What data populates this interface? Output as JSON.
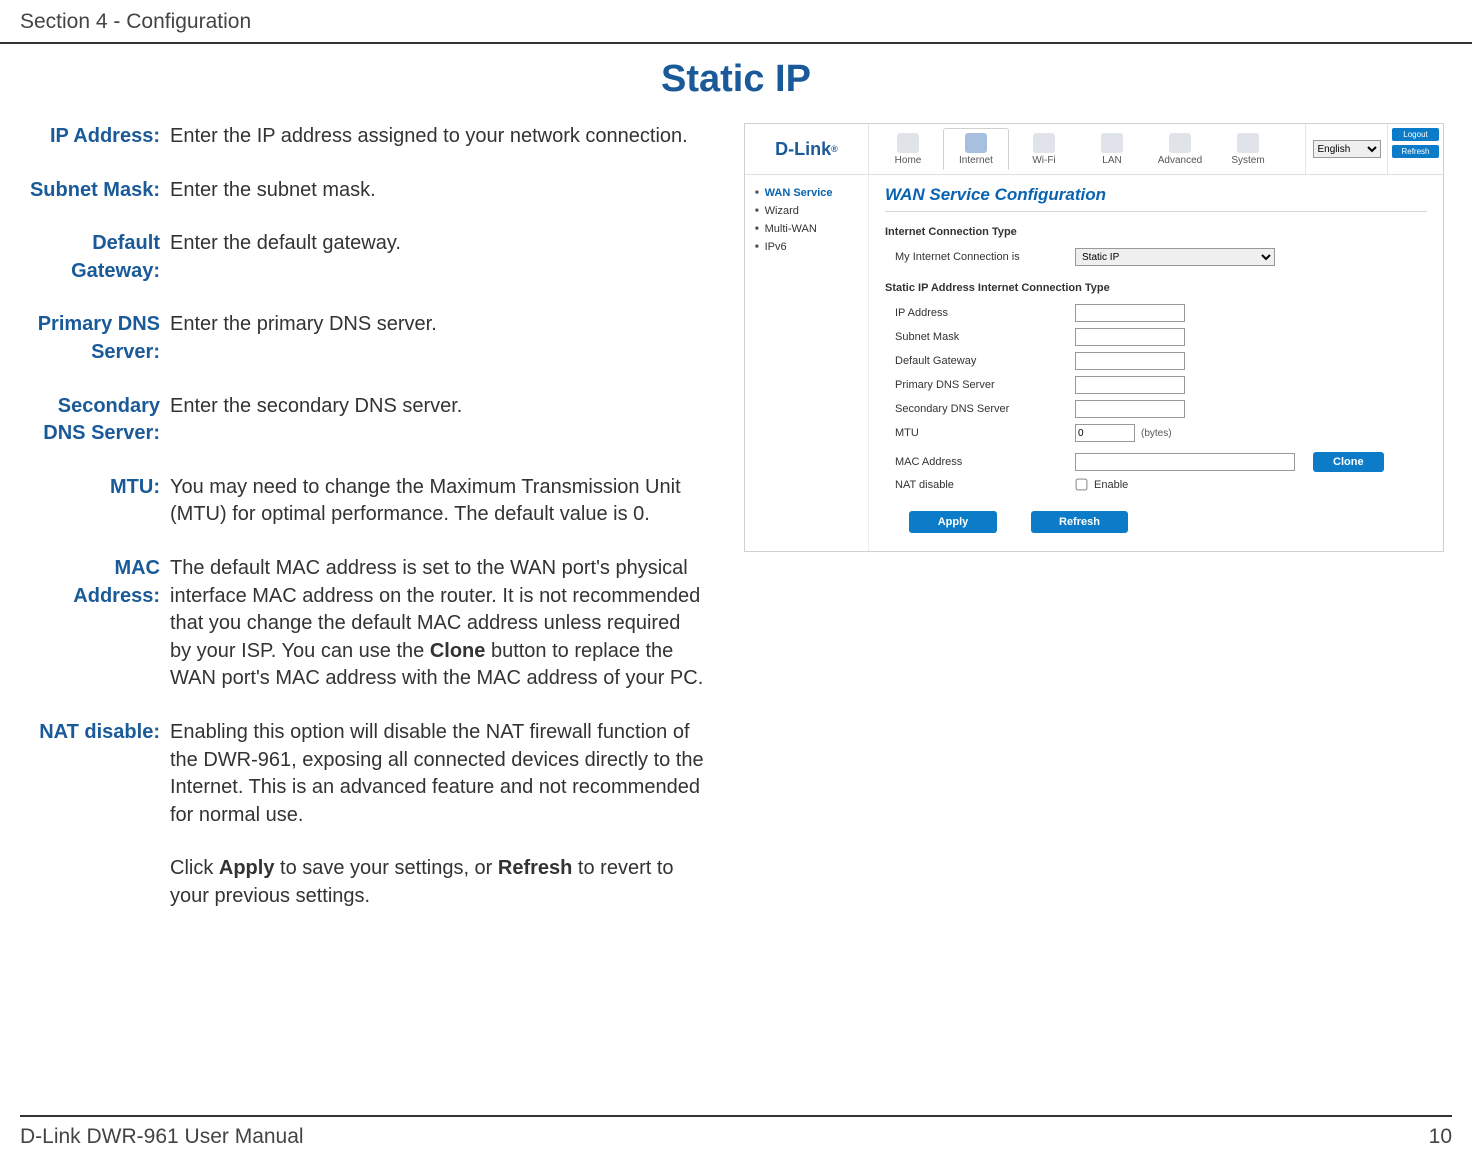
{
  "header": {
    "section": "Section 4 - Configuration"
  },
  "title": "Static IP",
  "definitions": [
    {
      "term": "IP Address:",
      "desc": "Enter the IP address assigned to your network connection."
    },
    {
      "term": "Subnet Mask:",
      "desc": "Enter the subnet mask."
    },
    {
      "term": "Default Gateway:",
      "desc": "Enter the default gateway."
    },
    {
      "term": "Primary DNS Server:",
      "desc": "Enter the primary DNS server."
    },
    {
      "term": "Secondary DNS Server:",
      "desc": "Enter the secondary DNS server."
    },
    {
      "term": "MTU:",
      "desc": "You may need to change the Maximum Transmission Unit (MTU) for optimal performance. The default value is 0."
    }
  ],
  "mac_row": {
    "term": "MAC Address:",
    "pre": "The default MAC address is set to the WAN port's physical interface MAC address on the router. It is not recommended that you change the default MAC address unless required by your ISP. You can use the ",
    "bold": "Clone",
    "post": " button to replace the WAN port's MAC address with the MAC address of your PC."
  },
  "nat_row": {
    "term": "NAT disable:",
    "desc": "Enabling this option will disable the NAT firewall function of the DWR-961, exposing all connected devices directly to the Internet. This is an advanced feature and not recommended for normal use."
  },
  "apply_note": {
    "p1": "Click ",
    "b1": "Apply",
    "p2": " to save your settings, or ",
    "b2": "Refresh",
    "p3": " to revert to your previous settings."
  },
  "footer": {
    "left": "D-Link DWR-961 User Manual",
    "right": "10"
  },
  "screenshot": {
    "brand": "D-Link",
    "nav": [
      "Home",
      "Internet",
      "Wi-Fi",
      "LAN",
      "Advanced",
      "System"
    ],
    "nav_active_index": 1,
    "lang": "English",
    "side_buttons": [
      "Logout",
      "Refresh"
    ],
    "sidebar": {
      "items": [
        "WAN Service",
        "Wizard",
        "Multi-WAN",
        "IPv6"
      ],
      "selected_index": 0
    },
    "panel_title": "WAN Service Configuration",
    "section1": {
      "head": "Internet Connection Type",
      "label": "My Internet Connection is",
      "value": "Static IP"
    },
    "section2": {
      "head": "Static IP Address Internet Connection Type",
      "fields": {
        "ip_address": {
          "label": "IP Address",
          "value": ""
        },
        "subnet_mask": {
          "label": "Subnet Mask",
          "value": ""
        },
        "default_gw": {
          "label": "Default Gateway",
          "value": ""
        },
        "primary_dns": {
          "label": "Primary DNS Server",
          "value": ""
        },
        "secondary_dns": {
          "label": "Secondary DNS Server",
          "value": ""
        },
        "mtu": {
          "label": "MTU",
          "value": "0",
          "unit": "(bytes)"
        },
        "mac": {
          "label": "MAC Address",
          "value": "",
          "button": "Clone"
        },
        "nat": {
          "label": "NAT disable",
          "text": "Enable"
        }
      }
    },
    "actions": {
      "apply": "Apply",
      "refresh": "Refresh"
    }
  }
}
